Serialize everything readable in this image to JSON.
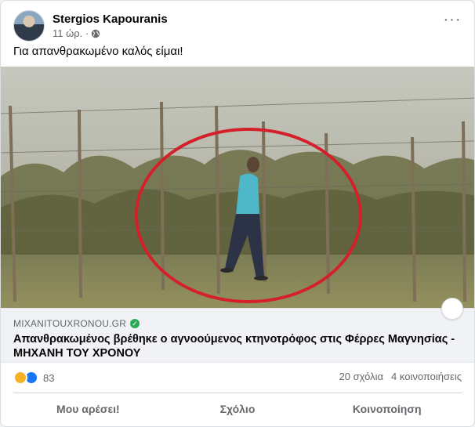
{
  "post": {
    "author": "Stergios Kapouranis",
    "time": "11 ώρ. ·",
    "text": "Για απανθρακωμένο καλός είμαι!",
    "more_icon": "more-horizontal-icon",
    "privacy_icon": "globe-icon"
  },
  "link": {
    "domain": "MIXANITOUXRONOU.GR",
    "title": "Απανθρακωμένος βρέθηκε ο αγνοούμενος κτηνοτρόφος στις Φέρρες Μαγνησίας - ΜΗΧΑΝΗ ΤΟΥ ΧΡΟΝΟΥ"
  },
  "stats": {
    "reactions_count": "83",
    "comments": "20 σχόλια",
    "shares": "4 κοινοποιήσεις"
  },
  "actions": {
    "like": "Μου αρέσει!",
    "comment": "Σχόλιο",
    "share": "Κοινοποίηση"
  },
  "colors": {
    "accent": "#1877f2",
    "circle_annotation": "#d4202a",
    "verified": "#2eaa54"
  }
}
